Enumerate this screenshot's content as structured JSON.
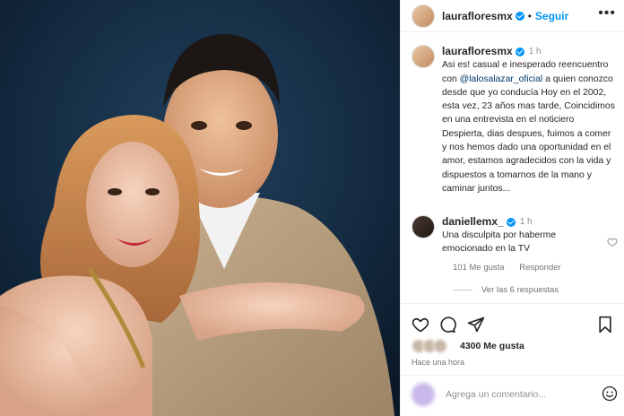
{
  "post": {
    "author": "laurafloresmx",
    "follow_label": "Seguir",
    "separator": "•",
    "more_label": "•••"
  },
  "caption": {
    "author": "laurafloresmx",
    "time": "1 h",
    "text_before_mention": "Asi es! casual e inesperado reencuentro con ",
    "mention": "@lalosalazar_oficial",
    "text_after_mention": " a quien conozco desde que yo conducía Hoy en el 2002, esta vez, 23 años mas tarde, Coincidimos en una entrevista en el noticiero Despierta, dias despues, fuimos a comer y nos hemos dado una oportunidad en el amor, estamos agradecidos con la vida y dispuestos a tomarnos de la mano y caminar juntos..."
  },
  "comment": {
    "author": "daniellemx_",
    "time": "1 h",
    "text": "Una disculpita por haberme emocionado en la TV",
    "likes": "101 Me gusta",
    "reply_label": "Responder",
    "view_replies": "Ver las 6 respuestas"
  },
  "actions": {
    "icons": [
      "heart-icon",
      "comment-icon",
      "share-icon",
      "bookmark-icon"
    ]
  },
  "stats": {
    "likes": "4300 Me gusta",
    "time_ago": "Hace una hora"
  },
  "add_comment": {
    "placeholder": "Agrega un comentario..."
  },
  "colors": {
    "accent": "#0095f6",
    "mention": "#00376b",
    "muted": "#737373"
  }
}
